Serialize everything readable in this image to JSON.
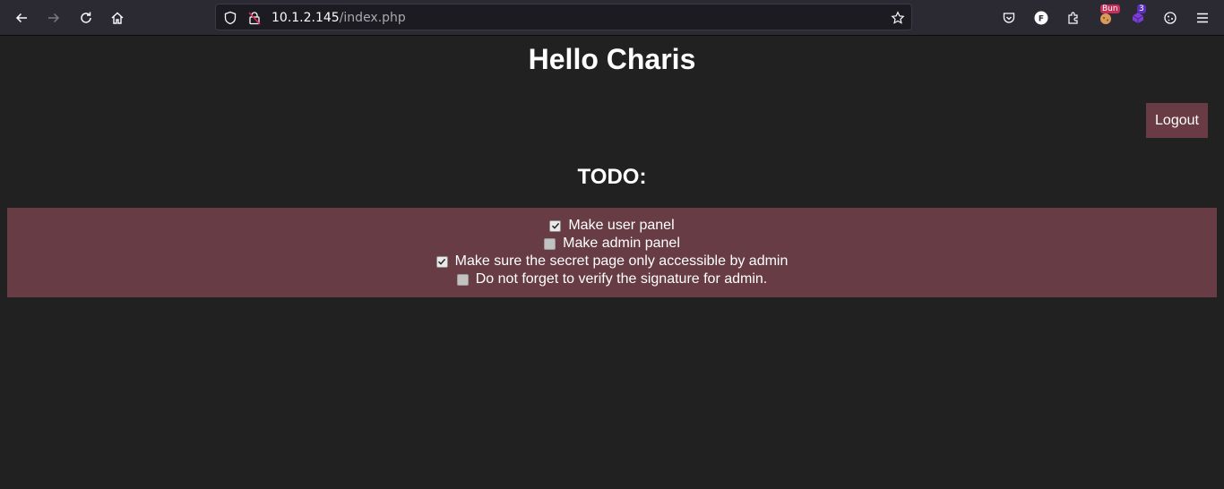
{
  "browser": {
    "url_host": "10.1.2.145",
    "url_path": "/index.php",
    "extensions": [
      {
        "name": "cookie-extension",
        "badge": "Bun"
      },
      {
        "name": "purple-extension",
        "badge": "3"
      }
    ]
  },
  "page": {
    "greeting": "Hello Charis",
    "logout_label": "Logout",
    "todo_title": "TODO:",
    "todo_items": [
      {
        "label": "Make user panel",
        "checked": true
      },
      {
        "label": "Make admin panel",
        "checked": false
      },
      {
        "label": "Make sure the secret page only accessible by admin",
        "checked": true
      },
      {
        "label": "Do not forget to verify the signature for admin.",
        "checked": false
      }
    ]
  },
  "colors": {
    "background": "#212121",
    "accent": "#683b45",
    "toolbar": "#2b2a33"
  }
}
